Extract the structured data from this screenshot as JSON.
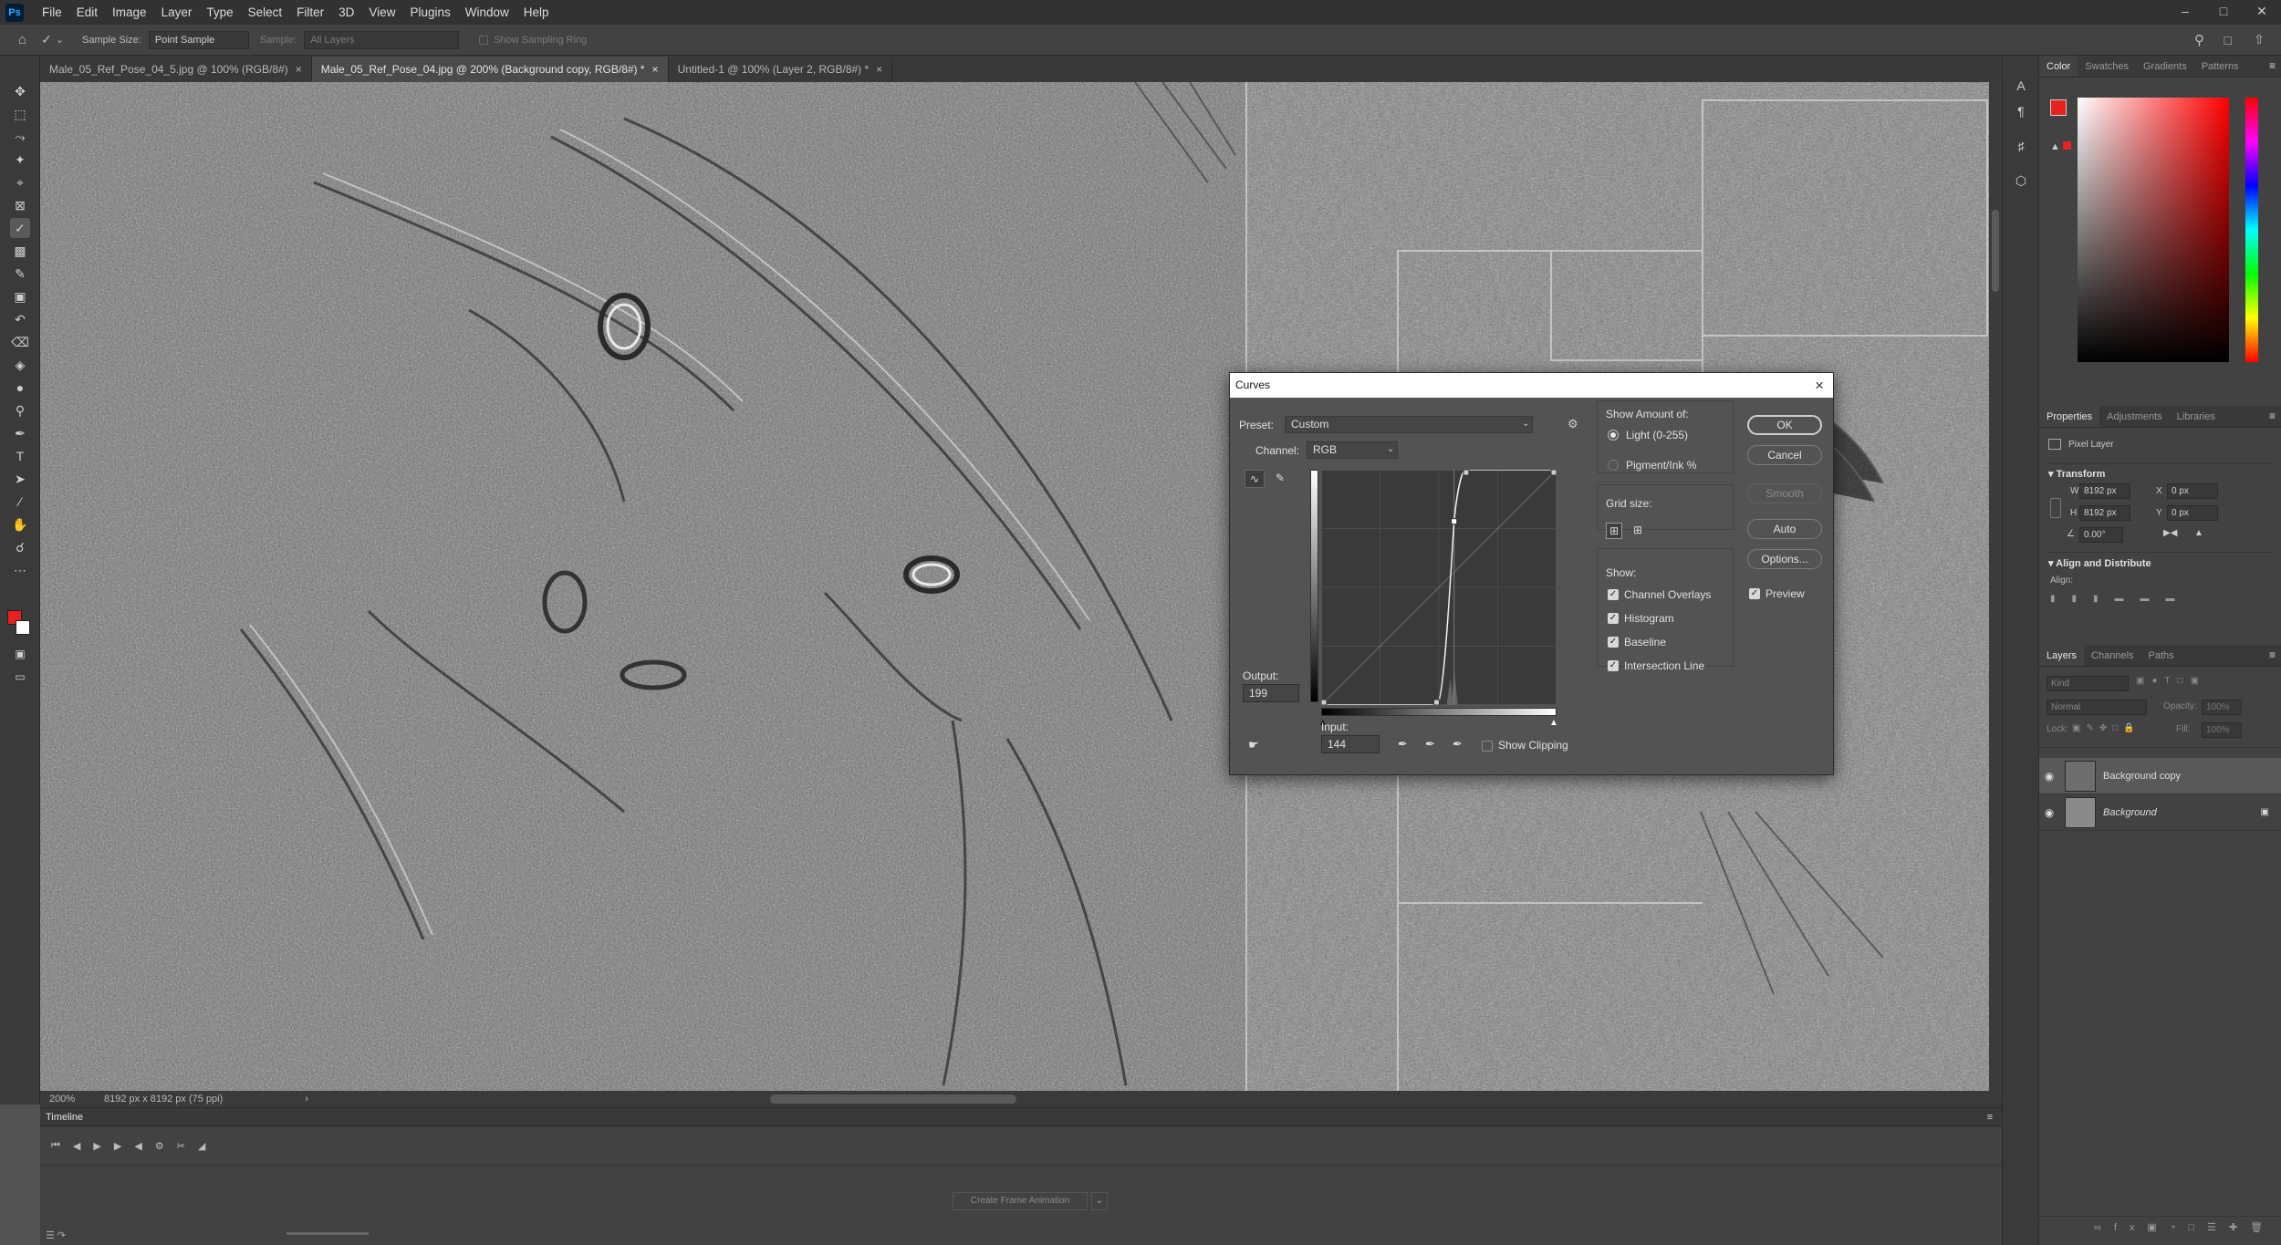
{
  "menubar": {
    "app_icon": "Ps",
    "items": [
      "File",
      "Edit",
      "Image",
      "Layer",
      "Type",
      "Select",
      "Filter",
      "3D",
      "View",
      "Plugins",
      "Window",
      "Help"
    ]
  },
  "options_bar": {
    "sample_size_label": "Sample Size:",
    "sample_size_value": "Point Sample",
    "sample_label": "Sample:",
    "sample_value": "All Layers",
    "sampling_ring_label": "Show Sampling Ring"
  },
  "tabs": [
    {
      "label": "Male_05_Ref_Pose_04_5.jpg @ 100% (RGB/8#)",
      "active": false
    },
    {
      "label": "Male_05_Ref_Pose_04.jpg @ 200% (Background copy, RGB/8#) *",
      "active": true
    },
    {
      "label": "Untitled-1 @ 100% (Layer 2, RGB/8#) *",
      "active": false
    }
  ],
  "statusbar": {
    "zoom": "200%",
    "doc_size": "8192 px x 8192 px (75 ppi)"
  },
  "timeline": {
    "title": "Timeline",
    "create_button": "Create Frame Animation"
  },
  "color_panel": {
    "tabs": [
      "Color",
      "Swatches",
      "Gradients",
      "Patterns"
    ],
    "fg_color": "#e8231f",
    "bg_color": "#ffffff",
    "hue_color": "#ff0000"
  },
  "properties_panel": {
    "tabs": [
      "Properties",
      "Adjustments",
      "Libraries"
    ],
    "layer_type": "Pixel Layer",
    "transform_title": "Transform",
    "w_label": "W",
    "w_value": "8192 px",
    "h_label": "H",
    "h_value": "8192 px",
    "x_label": "X",
    "x_value": "0 px",
    "y_label": "Y",
    "y_value": "0 px",
    "angle_value": "0.00°",
    "align_title": "Align and Distribute",
    "align_label": "Align:"
  },
  "layers_panel": {
    "tabs": [
      "Layers",
      "Channels",
      "Paths"
    ],
    "kind_placeholder": "Kind",
    "blend_mode": "Normal",
    "opacity_label": "Opacity:",
    "opacity_value": "100%",
    "lock_label": "Lock:",
    "fill_label": "Fill:",
    "fill_value": "100%",
    "layers": [
      {
        "name": "Background copy",
        "selected": true,
        "locked": false
      },
      {
        "name": "Background",
        "selected": false,
        "locked": true
      }
    ]
  },
  "curves_dialog": {
    "title": "Curves",
    "preset_label": "Preset:",
    "preset_value": "Custom",
    "channel_label": "Channel:",
    "channel_value": "RGB",
    "output_label": "Output:",
    "output_value": "199",
    "input_label": "Input:",
    "input_value": "144",
    "show_clipping_label": "Show Clipping",
    "show_amount_title": "Show Amount of:",
    "light_option": "Light  (0-255)",
    "pigment_option": "Pigment/Ink %",
    "grid_size_title": "Grid size:",
    "show_title": "Show:",
    "show_options": [
      "Channel Overlays",
      "Histogram",
      "Baseline",
      "Intersection Line"
    ],
    "buttons": {
      "ok": "OK",
      "cancel": "Cancel",
      "smooth": "Smooth",
      "auto": "Auto",
      "options": "Options..."
    },
    "preview_label": "Preview",
    "curve_points": [
      [
        0,
        0
      ],
      [
        125,
        0
      ],
      [
        144,
        199
      ],
      [
        157,
        255
      ],
      [
        255,
        255
      ]
    ]
  }
}
